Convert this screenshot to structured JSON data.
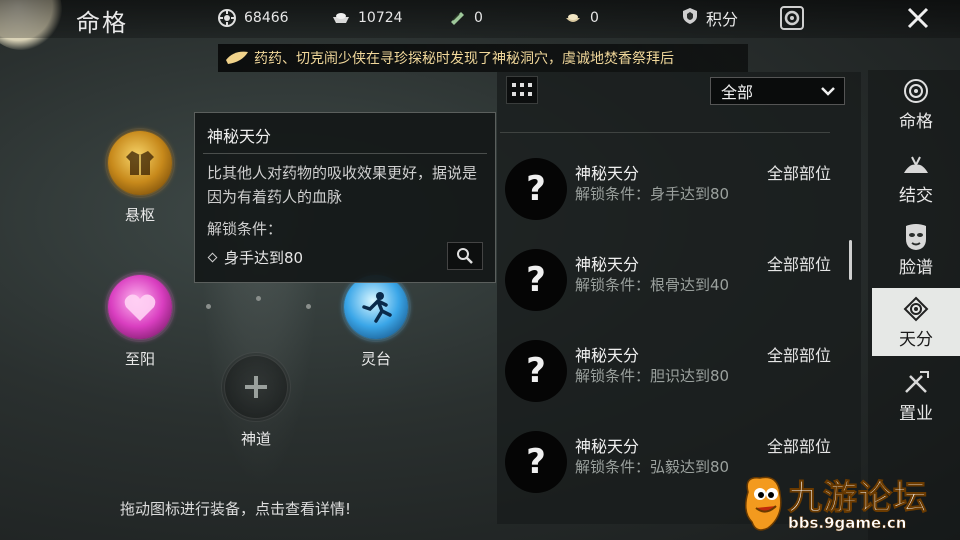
{
  "header": {
    "title": "命格"
  },
  "resources": [
    {
      "icon": "coin-icon",
      "value": "68466"
    },
    {
      "icon": "ingot-icon",
      "value": "10724"
    },
    {
      "icon": "ticket-icon",
      "value": "0"
    },
    {
      "icon": "treasure-bowl-icon",
      "value": "0"
    }
  ],
  "points": {
    "icon": "shield-icon",
    "label": "积分"
  },
  "ticker": {
    "text": "药药、切克闹少侠在寻珍探秘时发现了神秘洞穴，虞诚地焚香祭拜后"
  },
  "nodes": {
    "xuanshu": {
      "label": "悬枢"
    },
    "zhiyang": {
      "label": "至阳"
    },
    "lingtai": {
      "label": "灵台"
    },
    "shendao": {
      "label": "神道"
    }
  },
  "hint": "拖动图标进行装备，点击查看详情!",
  "tooltip": {
    "title": "神秘天分",
    "description": "比其他人对药物的吸收效果更好，据说是因为有着药人的血脉",
    "condition_label": "解锁条件：",
    "condition": "身手达到80"
  },
  "filter": {
    "selected": "全部"
  },
  "list": [
    {
      "name": "神秘天分",
      "condition": "解锁条件：身手达到80",
      "slot": "全部部位"
    },
    {
      "name": "神秘天分",
      "condition": "解锁条件：根骨达到40",
      "slot": "全部部位"
    },
    {
      "name": "神秘天分",
      "condition": "解锁条件：胆识达到80",
      "slot": "全部部位"
    },
    {
      "name": "神秘天分",
      "condition": "解锁条件：弘毅达到80",
      "slot": "全部部位"
    }
  ],
  "tabs": [
    {
      "label": "命格",
      "icon": "mingge-icon",
      "active": false
    },
    {
      "label": "结交",
      "icon": "friendship-icon",
      "active": false
    },
    {
      "label": "脸谱",
      "icon": "mask-icon",
      "active": false
    },
    {
      "label": "天分",
      "icon": "talent-icon",
      "active": true
    },
    {
      "label": "置业",
      "icon": "property-icon",
      "active": false
    }
  ],
  "watermark": {
    "title": "九游论坛",
    "url": "bbs.9game.cn"
  },
  "colors": {
    "ticker_text": "#f0d79a",
    "active_tab_bg": "#e6e8e6",
    "gold_orb": "#c7891b",
    "pink_orb": "#d93ec0",
    "blue_orb": "#3aa6e8"
  }
}
